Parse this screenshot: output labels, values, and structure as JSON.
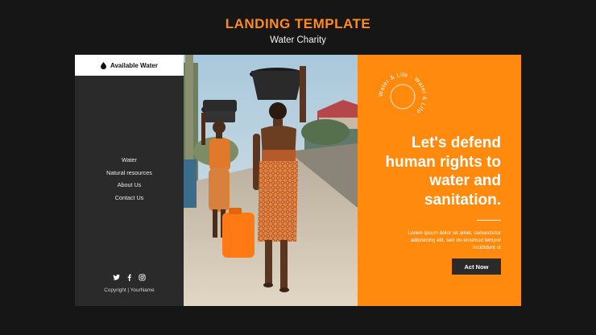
{
  "heading": {
    "title": "LANDING TEMPLATE",
    "subtitle": "Water Charity"
  },
  "sidebar": {
    "brand_label": "Available Water",
    "brand_icon": "water-drop-icon",
    "nav": [
      {
        "label": "Water"
      },
      {
        "label": "Natural resources"
      },
      {
        "label": "About Us"
      },
      {
        "label": "Contact Us"
      }
    ],
    "socials": [
      "twitter-icon",
      "facebook-icon",
      "instagram-icon"
    ],
    "copyright": "Copyright | YourName"
  },
  "panel": {
    "badge_text": "Water & Life · Water & Life · ",
    "headline": "Let's defend human rights to water and sanitation.",
    "body": "Lorem ipsum dolor sit amet, consectetur adipisicing elit, sed do eiusmod tempor incididunt ut",
    "cta_label": "Act Now"
  },
  "colors": {
    "accent": "#ff8a0e",
    "background": "#161616",
    "sidebar": "#2a2a2a",
    "cta_background": "#2a2a2a"
  }
}
